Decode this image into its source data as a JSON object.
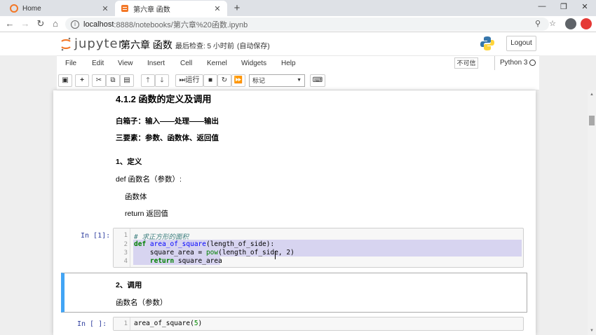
{
  "browser": {
    "tabs": [
      {
        "title": "Home",
        "active": false
      },
      {
        "title": "第六章 函数",
        "active": true
      }
    ],
    "url_host": "localhost",
    "url_path": ":8888/notebooks/第六章%20函数.ipynb"
  },
  "jupyter": {
    "logo_text": "jupyter",
    "notebook_title": "第六章 函数",
    "checkpoint_text": "最后检查: 5 小时前",
    "autosave_text": "(自动保存)",
    "logout_label": "Logout",
    "menus": [
      "File",
      "Edit",
      "View",
      "Insert",
      "Cell",
      "Kernel",
      "Widgets",
      "Help"
    ],
    "trusted_label": "不可信",
    "kernel_name": "Python 3",
    "toolbar": {
      "run_label": "运行",
      "celltype_value": "标记"
    }
  },
  "notebook": {
    "heading": "4.1.2 函数的定义及调用",
    "line1": "白箱子：输入——处理——输出",
    "line2": "三要素：参数、函数体、返回值",
    "section1": "1、定义",
    "def_line": "def  函数名（参数）:",
    "body_line": "函数体",
    "return_line": "return 返回值",
    "cell1": {
      "prompt": "In  [1]:",
      "line_numbers": [
        "1",
        "2",
        "3",
        "4"
      ],
      "comment": "# 求正方形的面积",
      "kw_def": "def",
      "fn_name": "area_of_square",
      "def_rest": "(length_of_side):",
      "l3_prefix": "    square_area = ",
      "l3_fn": "pow",
      "l3_rest": "(length_of_side, 2)",
      "l4_kw": "    return",
      "l4_rest": " square_area"
    },
    "section2": "2、调用",
    "call_line": "函数名（参数）",
    "cell2": {
      "prompt": "In  [ ]:",
      "line_numbers": [
        "1"
      ],
      "code_fn": "area_of_square",
      "code_open": "(",
      "code_num": "5",
      "code_close": ")"
    }
  },
  "colors": {
    "jupyter_orange": "#f37726",
    "prompt_blue": "#303f9f",
    "keyword_green": "#008000",
    "function_blue": "#0000ff",
    "comment_italic": "#408080",
    "number_green": "#080",
    "selected_cell_border": "#42a5f5"
  }
}
